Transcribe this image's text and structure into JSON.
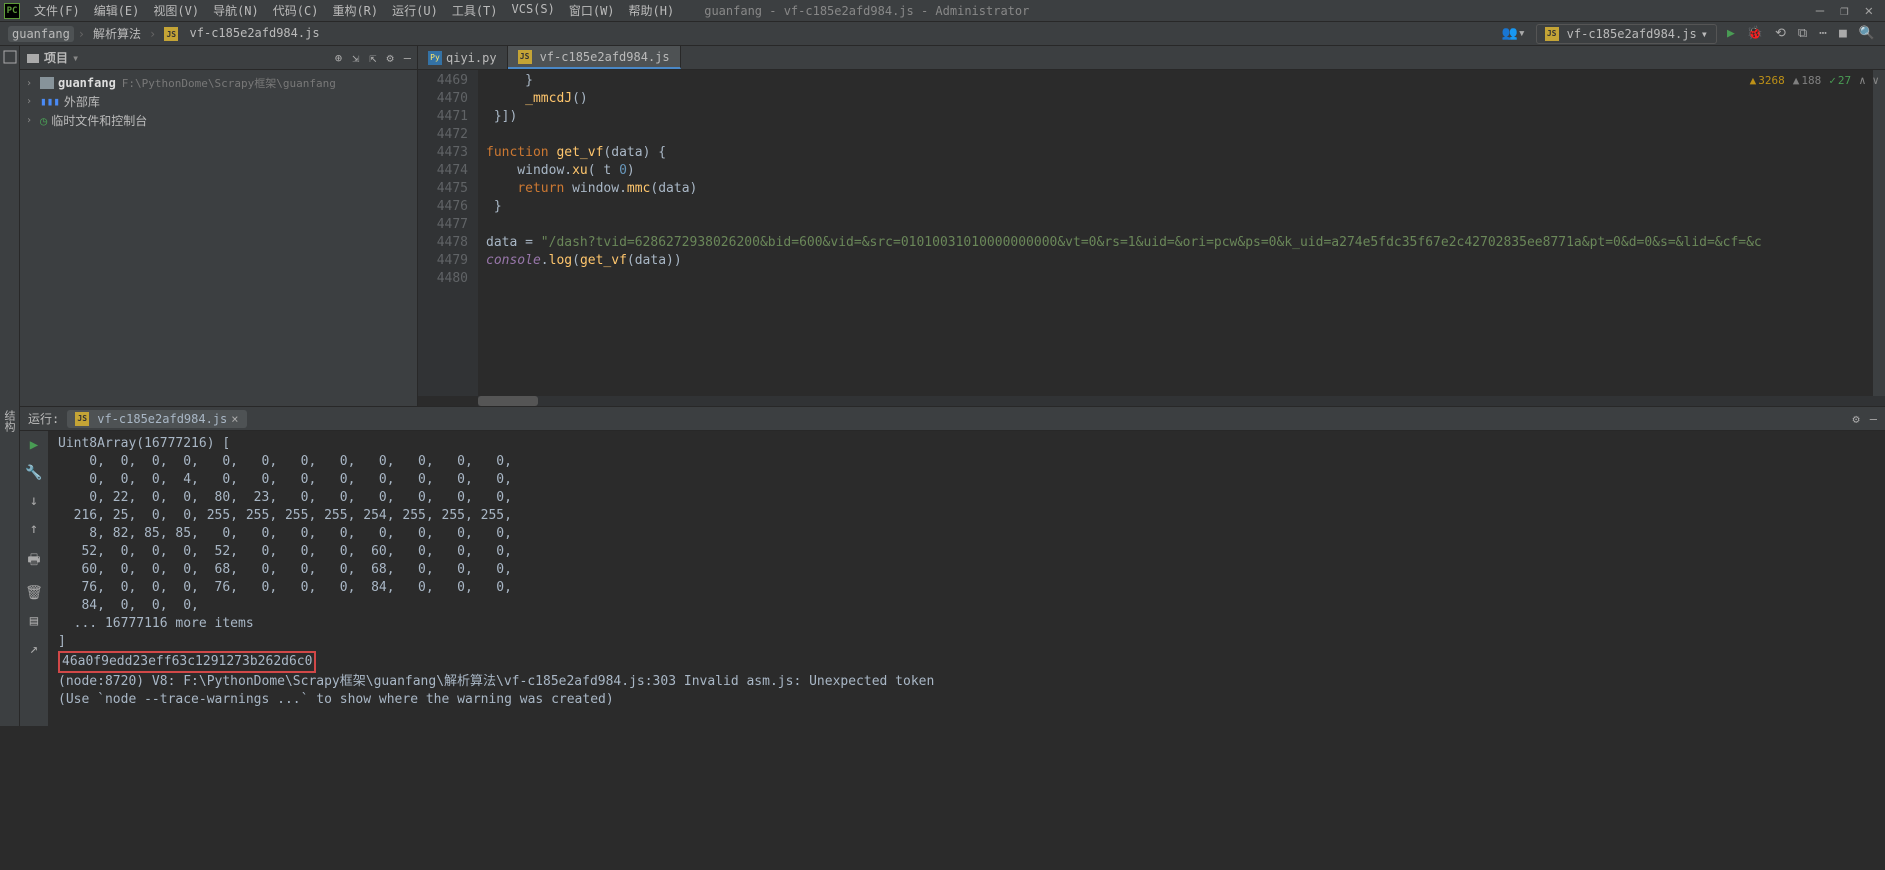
{
  "window": {
    "title": "guanfang - vf-c185e2afd984.js - Administrator"
  },
  "menu": {
    "file": "文件(F)",
    "edit": "编辑(E)",
    "view": "视图(V)",
    "navigate": "导航(N)",
    "code": "代码(C)",
    "refactor": "重构(R)",
    "run": "运行(U)",
    "tools": "工具(T)",
    "vcs": "VCS(S)",
    "window": "窗口(W)",
    "help": "帮助(H)"
  },
  "breadcrumb": {
    "c1": "guanfang",
    "c2": "解析算法",
    "c3": "vf-c185e2afd984.js"
  },
  "run_config": {
    "selected": "vf-c185e2afd984.js"
  },
  "project": {
    "title": "项目",
    "root": {
      "name": "guanfang",
      "path": "F:\\PythonDome\\Scrapy框架\\guanfang"
    },
    "ext_libs": "外部库",
    "scratch": "临时文件和控制台"
  },
  "tabs": {
    "t1": "qiyi.py",
    "t2": "vf-c185e2afd984.js"
  },
  "gutter": {
    "l1": "4469",
    "l2": "4470",
    "l3": "4471",
    "l4": "4472",
    "l5": "4473",
    "l6": "4474",
    "l7": "4475",
    "l8": "4476",
    "l9": "4477",
    "l10": "4478",
    "l11": "4479",
    "l12": "4480"
  },
  "code": {
    "l1_a": "     }",
    "l2_a": "     ",
    "l2_fn": "_mmcdJ",
    "l2_b": "()",
    "l3_a": " }])",
    "l5_kw": "function ",
    "l5_fn": "get_vf",
    "l5_a": "(",
    "l5_p": "data",
    "l5_b": ") {",
    "l6_a": "    window.",
    "l6_fn": "xu",
    "l6_b": "( t ",
    "l6_n": "0",
    "l6_c": ")",
    "l7_a": "    ",
    "l7_kw": "return ",
    "l7_b": "window.",
    "l7_fn": "mmc",
    "l7_c": "(",
    "l7_p": "data",
    "l7_d": ")",
    "l8_a": " }",
    "l10_v": "data",
    "l10_a": " = ",
    "l10_s": "\"/dash?tvid=6286272938026200&bid=600&vid=&src=01010031010000000000&vt=0&rs=1&uid=&ori=pcw&ps=0&k_uid=a274e5fdc35f67e2c42702835ee8771a&pt=0&d=0&s=&lid=&cf=&c",
    "l11_c": "console",
    "l11_a": ".",
    "l11_fn": "log",
    "l11_b": "(",
    "l11_fn2": "get_vf",
    "l11_c2": "(",
    "l11_p": "data",
    "l11_d": "))"
  },
  "inspections": {
    "warn_count": "3268",
    "weak_count": "188",
    "typo_count": "27"
  },
  "run_panel": {
    "label": "运行:",
    "tab": "vf-c185e2afd984.js"
  },
  "console": {
    "l1": "Uint8Array(16777216) [",
    "l2": "    0,  0,  0,  0,   0,   0,   0,   0,   0,   0,   0,   0,",
    "l3": "    0,  0,  0,  4,   0,   0,   0,   0,   0,   0,   0,   0,",
    "l4": "    0, 22,  0,  0,  80,  23,   0,   0,   0,   0,   0,   0,",
    "l5": "  216, 25,  0,  0, 255, 255, 255, 255, 254, 255, 255, 255,",
    "l6": "    8, 82, 85, 85,   0,   0,   0,   0,   0,   0,   0,   0,",
    "l7": "   52,  0,  0,  0,  52,   0,   0,   0,  60,   0,   0,   0,",
    "l8": "   60,  0,  0,  0,  68,   0,   0,   0,  68,   0,   0,   0,",
    "l9": "   76,  0,  0,  0,  76,   0,   0,   0,  84,   0,   0,   0,",
    "l10": "   84,  0,  0,  0,",
    "l11": "  ... 16777116 more items",
    "l12": "]",
    "hash": "46a0f9edd23eff63c1291273b262d6c0",
    "err1": "(node:8720) V8: F:\\PythonDome\\Scrapy框架\\guanfang\\解析算法\\vf-c185e2afd984.js:303 Invalid asm.js: Unexpected token",
    "err2": "(Use `node --trace-warnings ...` to show where the warning was created)"
  },
  "left_rail_tab": "结构"
}
